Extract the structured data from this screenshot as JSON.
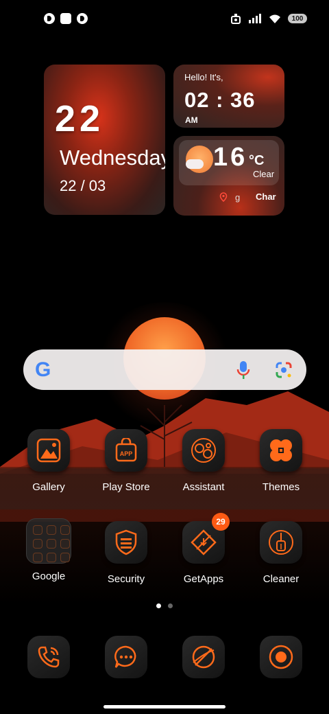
{
  "status_bar": {
    "battery": "100"
  },
  "clock_widget": {
    "day": "22",
    "weekday": "Wednesday",
    "date": "22 / 03"
  },
  "time_widget": {
    "greeting": "Hello! It's,",
    "time": "02 : 36",
    "ampm": "AM"
  },
  "weather_widget": {
    "temperature": "16",
    "unit": "°C",
    "condition": "Clear",
    "location_fragment": "g",
    "city_fragment": "Char"
  },
  "search_bar": {
    "logo": "G"
  },
  "apps_row1": [
    {
      "label": "Gallery",
      "icon": "gallery-icon"
    },
    {
      "label": "Play Store",
      "icon": "play-store-icon"
    },
    {
      "label": "Assistant",
      "icon": "assistant-icon"
    },
    {
      "label": "Themes",
      "icon": "themes-icon"
    }
  ],
  "apps_row2": [
    {
      "label": "Google",
      "icon": "google-folder-icon"
    },
    {
      "label": "Security",
      "icon": "security-icon"
    },
    {
      "label": "GetApps",
      "icon": "getapps-icon",
      "badge": "29"
    },
    {
      "label": "Cleaner",
      "icon": "cleaner-icon"
    }
  ],
  "dock": [
    {
      "icon": "phone-icon"
    },
    {
      "icon": "messages-icon"
    },
    {
      "icon": "browser-icon"
    },
    {
      "icon": "camera-icon"
    }
  ],
  "page_indicator": {
    "pages": 2,
    "active": 1
  },
  "accent_color": "#ff6a1a"
}
